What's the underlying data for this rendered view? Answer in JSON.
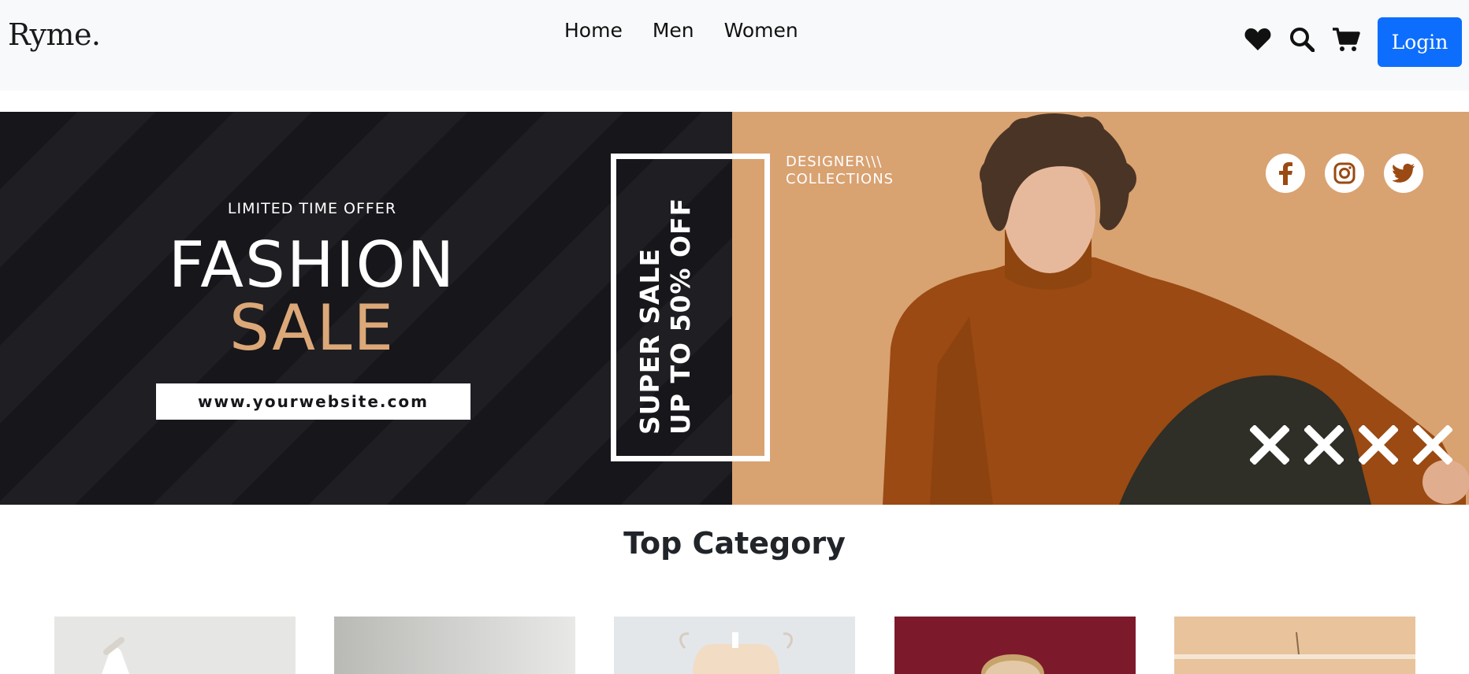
{
  "brand": {
    "name": "Ryme."
  },
  "nav": {
    "links": [
      {
        "label": "Home"
      },
      {
        "label": "Men"
      },
      {
        "label": "Women"
      }
    ],
    "icons": [
      "heart-icon",
      "search-icon",
      "cart-icon"
    ],
    "login_label": "Login",
    "login_color": "#0d6efd"
  },
  "banner": {
    "offer_label": "LIMITED TIME OFFER",
    "headline_1": "FASHION",
    "headline_2": "SALE",
    "website": "www.yourwebsite.com",
    "vertical_line_1": "SUPER SALE",
    "vertical_line_2": "UP TO 50% OFF",
    "designer_line_1": "DESIGNER\\\\\\",
    "designer_line_2": "COLLECTIONS",
    "social_icons": [
      "facebook-icon",
      "instagram-icon",
      "twitter-icon"
    ],
    "colors": {
      "dark": "#17161b",
      "tan": "#d9a271",
      "accent": "#dca878",
      "sweater": "#9a4a12"
    }
  },
  "section": {
    "title": "Top Category"
  },
  "categories": [
    {
      "bg": "#e5e5e3"
    },
    {
      "bg": "#c9c9c6"
    },
    {
      "bg": "#e3e7ea"
    },
    {
      "bg": "#7c1a2c"
    },
    {
      "bg": "#e7c29c"
    }
  ]
}
